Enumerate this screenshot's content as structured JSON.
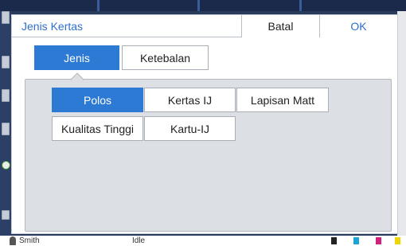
{
  "dialog": {
    "title": "Jenis Kertas",
    "cancel_label": "Batal",
    "ok_label": "OK"
  },
  "tabs": [
    {
      "label": "Jenis",
      "active": true
    },
    {
      "label": "Ketebalan",
      "active": false
    }
  ],
  "options": [
    {
      "label": "Polos",
      "selected": true
    },
    {
      "label": "Kertas IJ",
      "selected": false
    },
    {
      "label": "Lapisan Matt",
      "selected": false
    },
    {
      "label": "Kualitas Tinggi",
      "selected": false
    },
    {
      "label": "Kartu-IJ",
      "selected": false
    }
  ],
  "background": {
    "user": "Smith",
    "status": "Idle"
  },
  "colors": {
    "accent": "#2d7ad4",
    "title_text": "#2f6fc9",
    "panel": "#dcdfe3",
    "ink_cyan": "#1aa5d6",
    "ink_magenta": "#d1207e",
    "ink_yellow": "#f0d400",
    "ink_black": "#222222"
  }
}
